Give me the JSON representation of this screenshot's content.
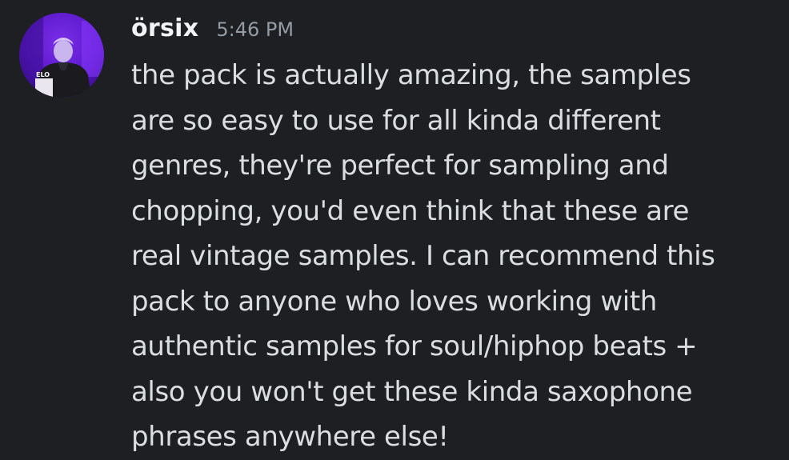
{
  "message": {
    "author": "örsix",
    "timestamp": "5:46 PM",
    "avatar_icon": "user-avatar",
    "avatar_text": "ELO",
    "lines": [
      "the pack is actually amazing, the samples",
      "are so easy to use for all kinda different",
      "genres, they're perfect for sampling and",
      "chopping, you'd even think that these are",
      "real vintage samples. I can recommend this",
      "pack to anyone who loves working with",
      "authentic samples for soul/hiphop beats +",
      "also you won't get these kinda saxophone",
      "phrases anywhere else!"
    ]
  },
  "colors": {
    "background": "#1e1f23",
    "username": "#f2f3f5",
    "timestamp": "#949ba4",
    "text": "#dbdee1"
  }
}
